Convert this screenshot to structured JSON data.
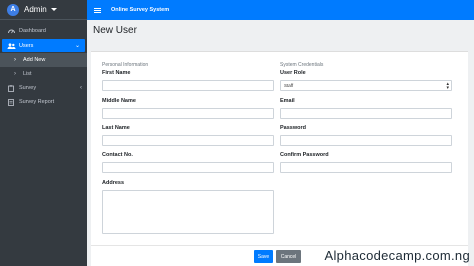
{
  "sidebar": {
    "avatar_letter": "A",
    "user_name": "Admin",
    "items": [
      {
        "label": "Dashboard",
        "icon": "dashboard-icon"
      },
      {
        "label": "Users",
        "icon": "users-icon"
      },
      {
        "label": "Add New",
        "icon": "chevron-right-icon"
      },
      {
        "label": "List",
        "icon": "chevron-right-icon"
      },
      {
        "label": "Survey",
        "icon": "clipboard-icon"
      },
      {
        "label": "Survey Report",
        "icon": "report-icon"
      }
    ]
  },
  "header": {
    "title": "Online Survey System"
  },
  "page": {
    "title": "New User"
  },
  "form": {
    "personal_section": "Personal Information",
    "credentials_section": "System Credentials",
    "first_name_label": "First Name",
    "middle_name_label": "Middle Name",
    "last_name_label": "Last Name",
    "contact_label": "Contact No.",
    "address_label": "Address",
    "user_role_label": "User Role",
    "user_role_value": "Staff",
    "email_label": "Email",
    "password_label": "Password",
    "confirm_password_label": "Confirm Password",
    "save_label": "Save",
    "cancel_label": "Cancel"
  },
  "watermark": "Alphacodecamp.com.ng",
  "colors": {
    "primary": "#007bff",
    "sidebar_bg": "#343a40",
    "secondary": "#6c757d"
  }
}
